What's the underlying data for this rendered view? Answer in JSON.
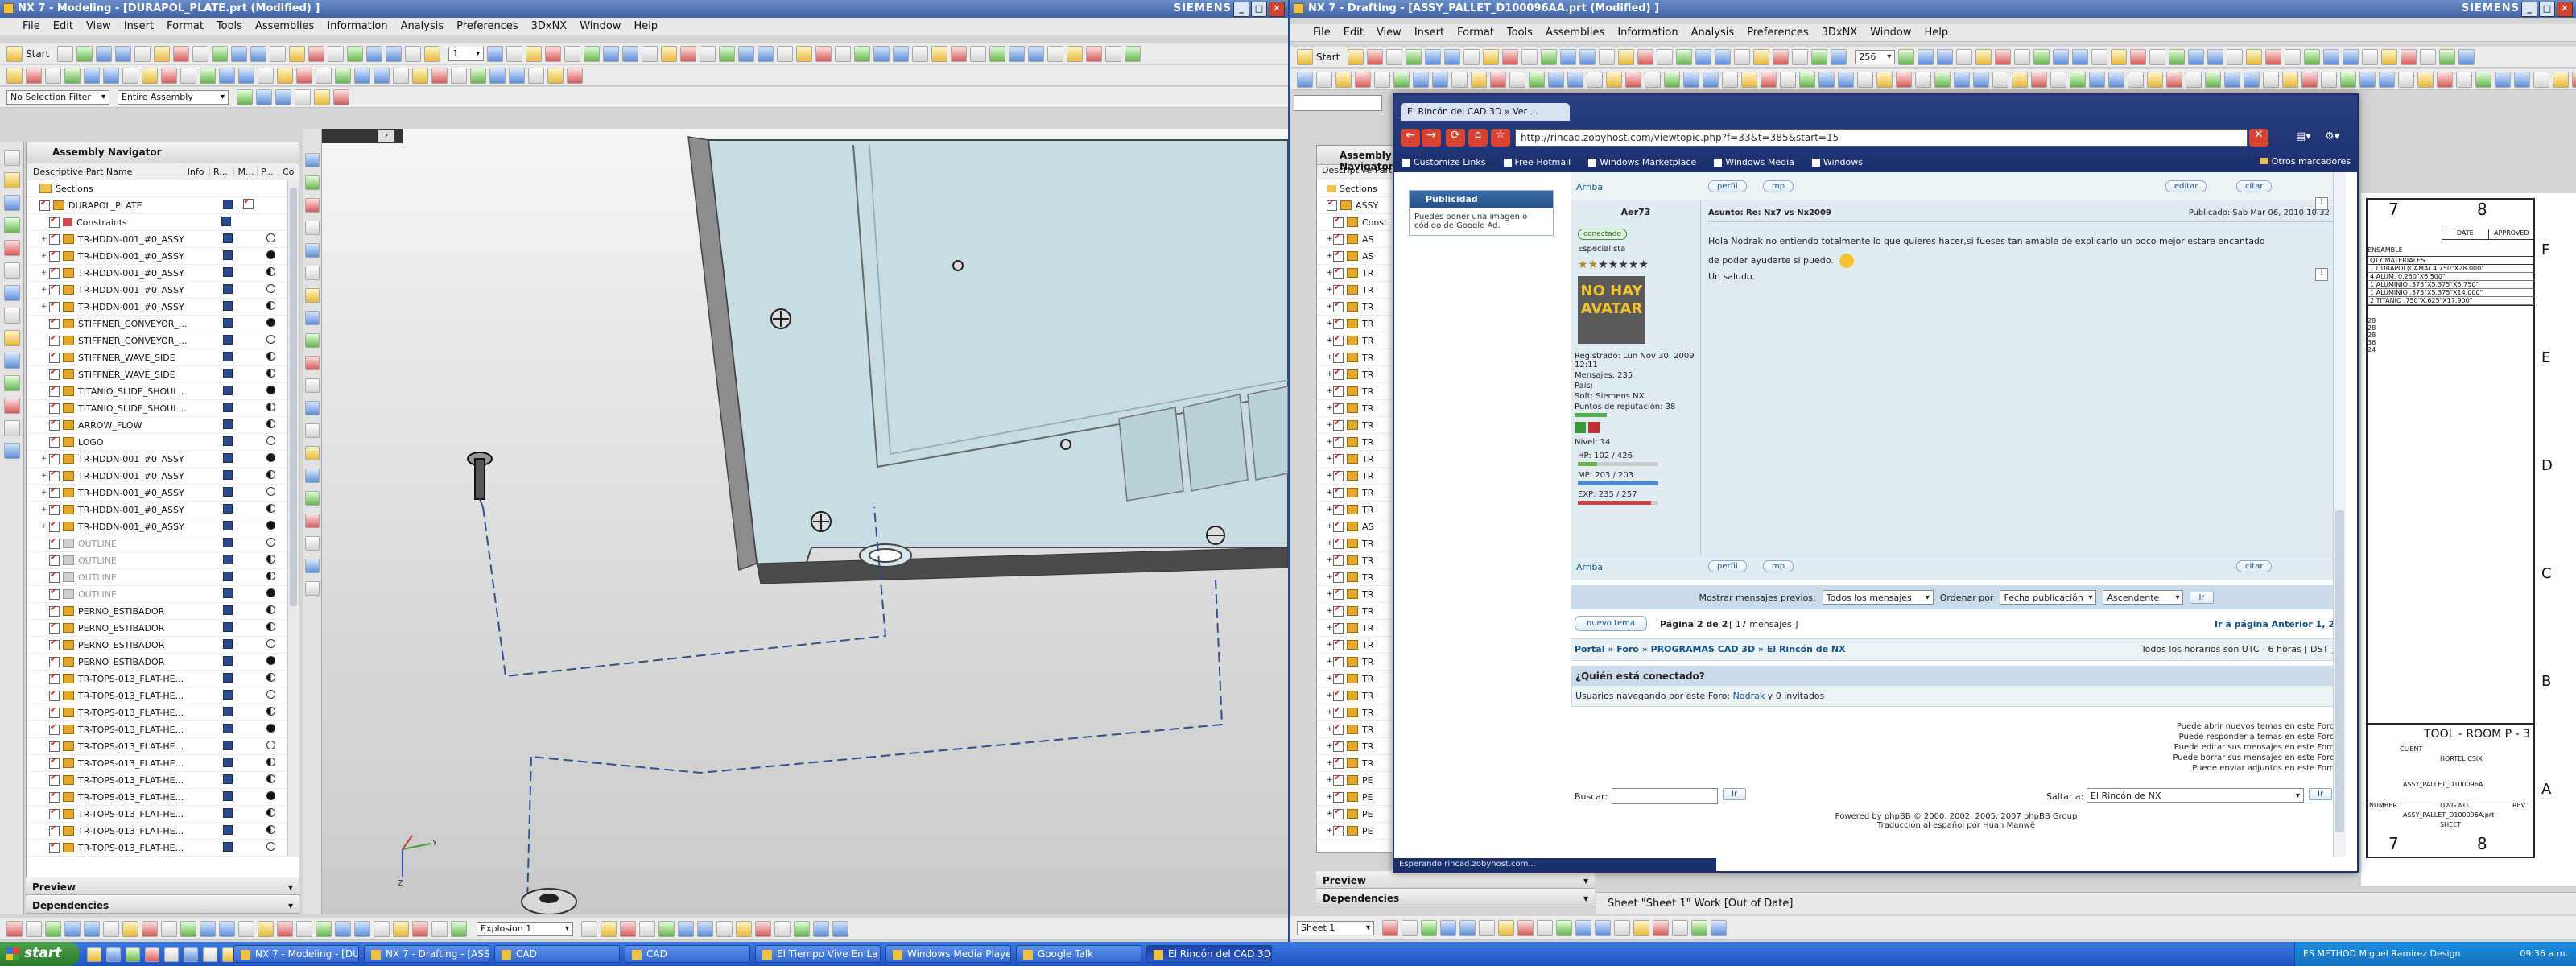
{
  "left": {
    "title": "NX 7 - Modeling - [DURAPOL_PLATE.prt (Modified) ]",
    "brand": "SIEMENS",
    "menu": [
      "File",
      "Edit",
      "View",
      "Insert",
      "Format",
      "Tools",
      "Assemblies",
      "Information",
      "Analysis",
      "Preferences",
      "3DxNX",
      "Window",
      "Help"
    ],
    "start_label": "Start",
    "selection_filter": "No Selection Filter",
    "assembly_scope": "Entire Assembly",
    "layer_value": "1",
    "navigator": {
      "title": "Assembly Navigator",
      "columns": [
        "Descriptive Part Name",
        "Info",
        "R...",
        "M...",
        "P...",
        "Co"
      ],
      "rows": [
        {
          "name": "Sections",
          "type": "folder",
          "grey": false
        },
        {
          "name": "DURAPOL_PLATE",
          "type": "part",
          "grey": false
        },
        {
          "name": "Constraints",
          "type": "constraint",
          "grey": false
        },
        {
          "name": "TR-HDDN-001_#0_ASSY",
          "type": "part",
          "grey": false
        },
        {
          "name": "TR-HDDN-001_#0_ASSY",
          "type": "part",
          "grey": false
        },
        {
          "name": "TR-HDDN-001_#0_ASSY",
          "type": "part",
          "grey": false
        },
        {
          "name": "TR-HDDN-001_#0_ASSY",
          "type": "part",
          "grey": false
        },
        {
          "name": "TR-HDDN-001_#0_ASSY",
          "type": "part",
          "grey": false
        },
        {
          "name": "STIFFNER_CONVEYOR_...",
          "type": "part",
          "grey": false
        },
        {
          "name": "STIFFNER_CONVEYOR_...",
          "type": "part",
          "grey": false
        },
        {
          "name": "STIFFNER_WAVE_SIDE",
          "type": "part",
          "grey": false
        },
        {
          "name": "STIFFNER_WAVE_SIDE",
          "type": "part",
          "grey": false
        },
        {
          "name": "TITANIO_SLIDE_SHOUL...",
          "type": "part",
          "grey": false
        },
        {
          "name": "TITANIO_SLIDE_SHOUL...",
          "type": "part",
          "grey": false
        },
        {
          "name": "ARROW_FLOW",
          "type": "part",
          "grey": false
        },
        {
          "name": "LOGO",
          "type": "part",
          "grey": false
        },
        {
          "name": "TR-HDDN-001_#0_ASSY",
          "type": "part",
          "grey": false
        },
        {
          "name": "TR-HDDN-001_#0_ASSY",
          "type": "part",
          "grey": false
        },
        {
          "name": "TR-HDDN-001_#0_ASSY",
          "type": "part",
          "grey": false
        },
        {
          "name": "TR-HDDN-001_#0_ASSY",
          "type": "part",
          "grey": false
        },
        {
          "name": "TR-HDDN-001_#0_ASSY",
          "type": "part",
          "grey": false
        },
        {
          "name": "OUTLINE",
          "type": "part",
          "grey": true
        },
        {
          "name": "OUTLINE",
          "type": "part",
          "grey": true
        },
        {
          "name": "OUTLINE",
          "type": "part",
          "grey": true
        },
        {
          "name": "OUTLINE",
          "type": "part",
          "grey": true
        },
        {
          "name": "PERNO_ESTIBADOR",
          "type": "part",
          "grey": false
        },
        {
          "name": "PERNO_ESTIBADOR",
          "type": "part",
          "grey": false
        },
        {
          "name": "PERNO_ESTIBADOR",
          "type": "part",
          "grey": false
        },
        {
          "name": "PERNO_ESTIBADOR",
          "type": "part",
          "grey": false
        },
        {
          "name": "TR-TOPS-013_FLAT-HE...",
          "type": "part",
          "grey": false
        },
        {
          "name": "TR-TOPS-013_FLAT-HE...",
          "type": "part",
          "grey": false
        },
        {
          "name": "TR-TOPS-013_FLAT-HE...",
          "type": "part",
          "grey": false
        },
        {
          "name": "TR-TOPS-013_FLAT-HE...",
          "type": "part",
          "grey": false
        },
        {
          "name": "TR-TOPS-013_FLAT-HE...",
          "type": "part",
          "grey": false
        },
        {
          "name": "TR-TOPS-013_FLAT-HE...",
          "type": "part",
          "grey": false
        },
        {
          "name": "TR-TOPS-013_FLAT-HE...",
          "type": "part",
          "grey": false
        },
        {
          "name": "TR-TOPS-013_FLAT-HE...",
          "type": "part",
          "grey": false
        },
        {
          "name": "TR-TOPS-013_FLAT-HE...",
          "type": "part",
          "grey": false
        },
        {
          "name": "TR-TOPS-013_FLAT-HE...",
          "type": "part",
          "grey": false
        },
        {
          "name": "TR-TOPS-013_FLAT-HE...",
          "type": "part",
          "grey": false
        },
        {
          "name": "TR-TOPS-013_FLAT-HE...",
          "type": "part",
          "grey": false
        },
        {
          "name": "TR-TOPS-013_FLAT-HE...",
          "type": "part",
          "grey": false
        }
      ],
      "preview_label": "Preview",
      "dependencies_label": "Dependencies"
    },
    "explosion_value": "Explosion 1"
  },
  "right": {
    "title": "NX 7 - Drafting - [ASSY_PALLET_D100096AA.prt (Modified) ]",
    "brand": "SIEMENS",
    "menu": [
      "File",
      "Edit",
      "View",
      "Insert",
      "Format",
      "Tools",
      "Assemblies",
      "Information",
      "Analysis",
      "Preferences",
      "3DxNX",
      "Window",
      "Help"
    ],
    "start_label": "Start",
    "scale_value": "256",
    "nav_title": "Assembly Navigator",
    "nav_col": "Descriptive Part",
    "nav_items": [
      "Sections",
      "ASSY",
      "Const",
      "AS",
      "AS",
      "TR",
      "TR",
      "TR",
      "TR",
      "TR",
      "TR",
      "TR",
      "TR",
      "TR",
      "TR",
      "TR",
      "TR",
      "TR",
      "TR",
      "TR",
      "AS",
      "TR",
      "TR",
      "TR",
      "TR",
      "TR",
      "TR",
      "TR",
      "TR",
      "TR",
      "TR",
      "TR",
      "TR",
      "TR",
      "TR",
      "PE",
      "PE",
      "PE",
      "PE"
    ],
    "preview_label": "Preview",
    "dependencies_label": "Dependencies",
    "status_text": "Sheet \"Sheet 1\" Work [Out of Date]",
    "sheet_value": "Sheet 1",
    "title_block": {
      "col_numbers": [
        "7",
        "8"
      ],
      "row_letters": [
        "F",
        "E",
        "D",
        "C",
        "B",
        "A"
      ],
      "date_label": "DATE",
      "approved_label": "APPROVED",
      "assemble_label": "ENSAMBLE",
      "bom_header": "QTY MATERIALES",
      "bom_rows": [
        "1  DURAPOL(CAMA) 4.750\"X28.000\"",
        "4  ALUM. 0.250\"X6.500\"",
        "1  ALUMINIO .375\"X5.375\"X5.750\"",
        "1  ALUMINIO .375\"X5.375\"X14.000\"",
        "2  TITANIO .750\"X.625\"X17.900\""
      ],
      "row_nums": [
        "28",
        "28",
        "28",
        "36",
        "24"
      ],
      "company": "TOOL - ROOM  P - 3",
      "client_label": "CLIENT",
      "client_value": "HORTEL CSIX",
      "part_title": "ASSY_PALLET_D100096A",
      "number_label": "NUMBER",
      "dwg_label": "DWG NO.",
      "rev_label": "REV.",
      "dwg_value": "ASSY_PALLET_D100096A.prt",
      "sheet_label": "SHEET"
    }
  },
  "browser": {
    "tab_title": "El Rincón del CAD 3D » Ver ...",
    "url": "http://rincad.zobyhost.com/viewtopic.php?f=33&t=385&start=15",
    "bookmarks": [
      "Customize Links",
      "Free Hotmail",
      "Windows Marketplace",
      "Windows Media",
      "Windows"
    ],
    "other_bookmarks": "Otros marcadores",
    "ad_title": "Publicidad",
    "ad_text": "Puedes poner una imagen o código de Google Ad.",
    "top_link": "Arriba",
    "profile_btn": "perfil",
    "pm_btn": "mp",
    "edit_btn": "editar",
    "quote_btn": "citar",
    "post": {
      "author": "Aer73",
      "online": "conectado",
      "rank": "Especialista",
      "avatar_text": "NO HAY AVATAR",
      "subject": "Asunto: Re: Nx7 vs Nx2009",
      "posted": "Publicado: Sab Mar 06, 2010 10:32",
      "body_1": "Hola Nodrak no entiendo totalmente lo que quieres hacer,si fueses tan amable de explicarlo un poco mejor estare encantado",
      "body_2": "de poder ayudarte si puedo.",
      "body_3": "Un saludo.",
      "registered": "Registrado: Lun Nov 30, 2009 12:11",
      "messages": "Mensajes: 235",
      "country": "País:",
      "soft": "Soft: Siemens NX",
      "rep": "Puntos de reputación: 38",
      "level": "Nivel: 14",
      "hp": "HP: 102 / 426",
      "mp": "MP: 203 / 203",
      "exp": "EXP: 235 / 257",
      "hp_frac": 0.24,
      "mp_frac": 1.0,
      "exp_frac": 0.91
    },
    "filter_label": "Mostrar mensajes previos:",
    "filter_all": "Todos los mensajes",
    "order_label": "Ordenar por",
    "order_value": "Fecha publicación",
    "direction_value": "Ascendente",
    "go_btn": "Ir",
    "new_topic": "nuevo tema",
    "page_info": "Página 2 de 2",
    "msg_count": "[ 17 mensajes ]",
    "goto_prev": "Ir a página Anterior  1, 2",
    "breadcrumb": "Portal » Foro » PROGRAMAS CAD 3D » El Rincón de NX",
    "timezone": "Todos los horarios son UTC - 6 horas [ DST ]",
    "who_title": "¿Quién está conectado?",
    "who_text_a": "Usuarios navegando por este Foro:",
    "who_user": "Nodrak",
    "who_text_b": "y 0 invitados",
    "perms": [
      "Puede abrir nuevos temas en este Foro",
      "Puede responder a temas en este Foro",
      "Puede editar sus mensajes en este Foro",
      "Puede borrar sus mensajes en este Foro",
      "Puede enviar adjuntos en este Foro"
    ],
    "search_label": "Buscar:",
    "jump_label": "Saltar a:",
    "jump_value": "El Rincón de NX",
    "footer_1": "Powered by phpBB © 2000, 2002, 2005, 2007 phpBB Group",
    "footer_2": "Traducción al español por Huan Manwë",
    "status": "Esperando rincad.zobyhost.com..."
  },
  "taskbar": {
    "start": "start",
    "tasks": [
      "NX 7 - Modeling - [DU...",
      "NX 7 - Drafting - [ASS...",
      "CAD",
      "CAD",
      "El Tiempo Vive En La ...",
      "Windows Media Player",
      "Google Talk",
      "El Rincón del CAD 3D ..."
    ],
    "tray_text": "ES   METHOD   Miguel Ramirez   Design",
    "clock": "09:36 a.m."
  },
  "colors": {
    "nx_blue": "#3f63a8",
    "browser_navy": "#1c2f6d",
    "forum_blue": "#105289",
    "taskbar": "#2558cc"
  }
}
